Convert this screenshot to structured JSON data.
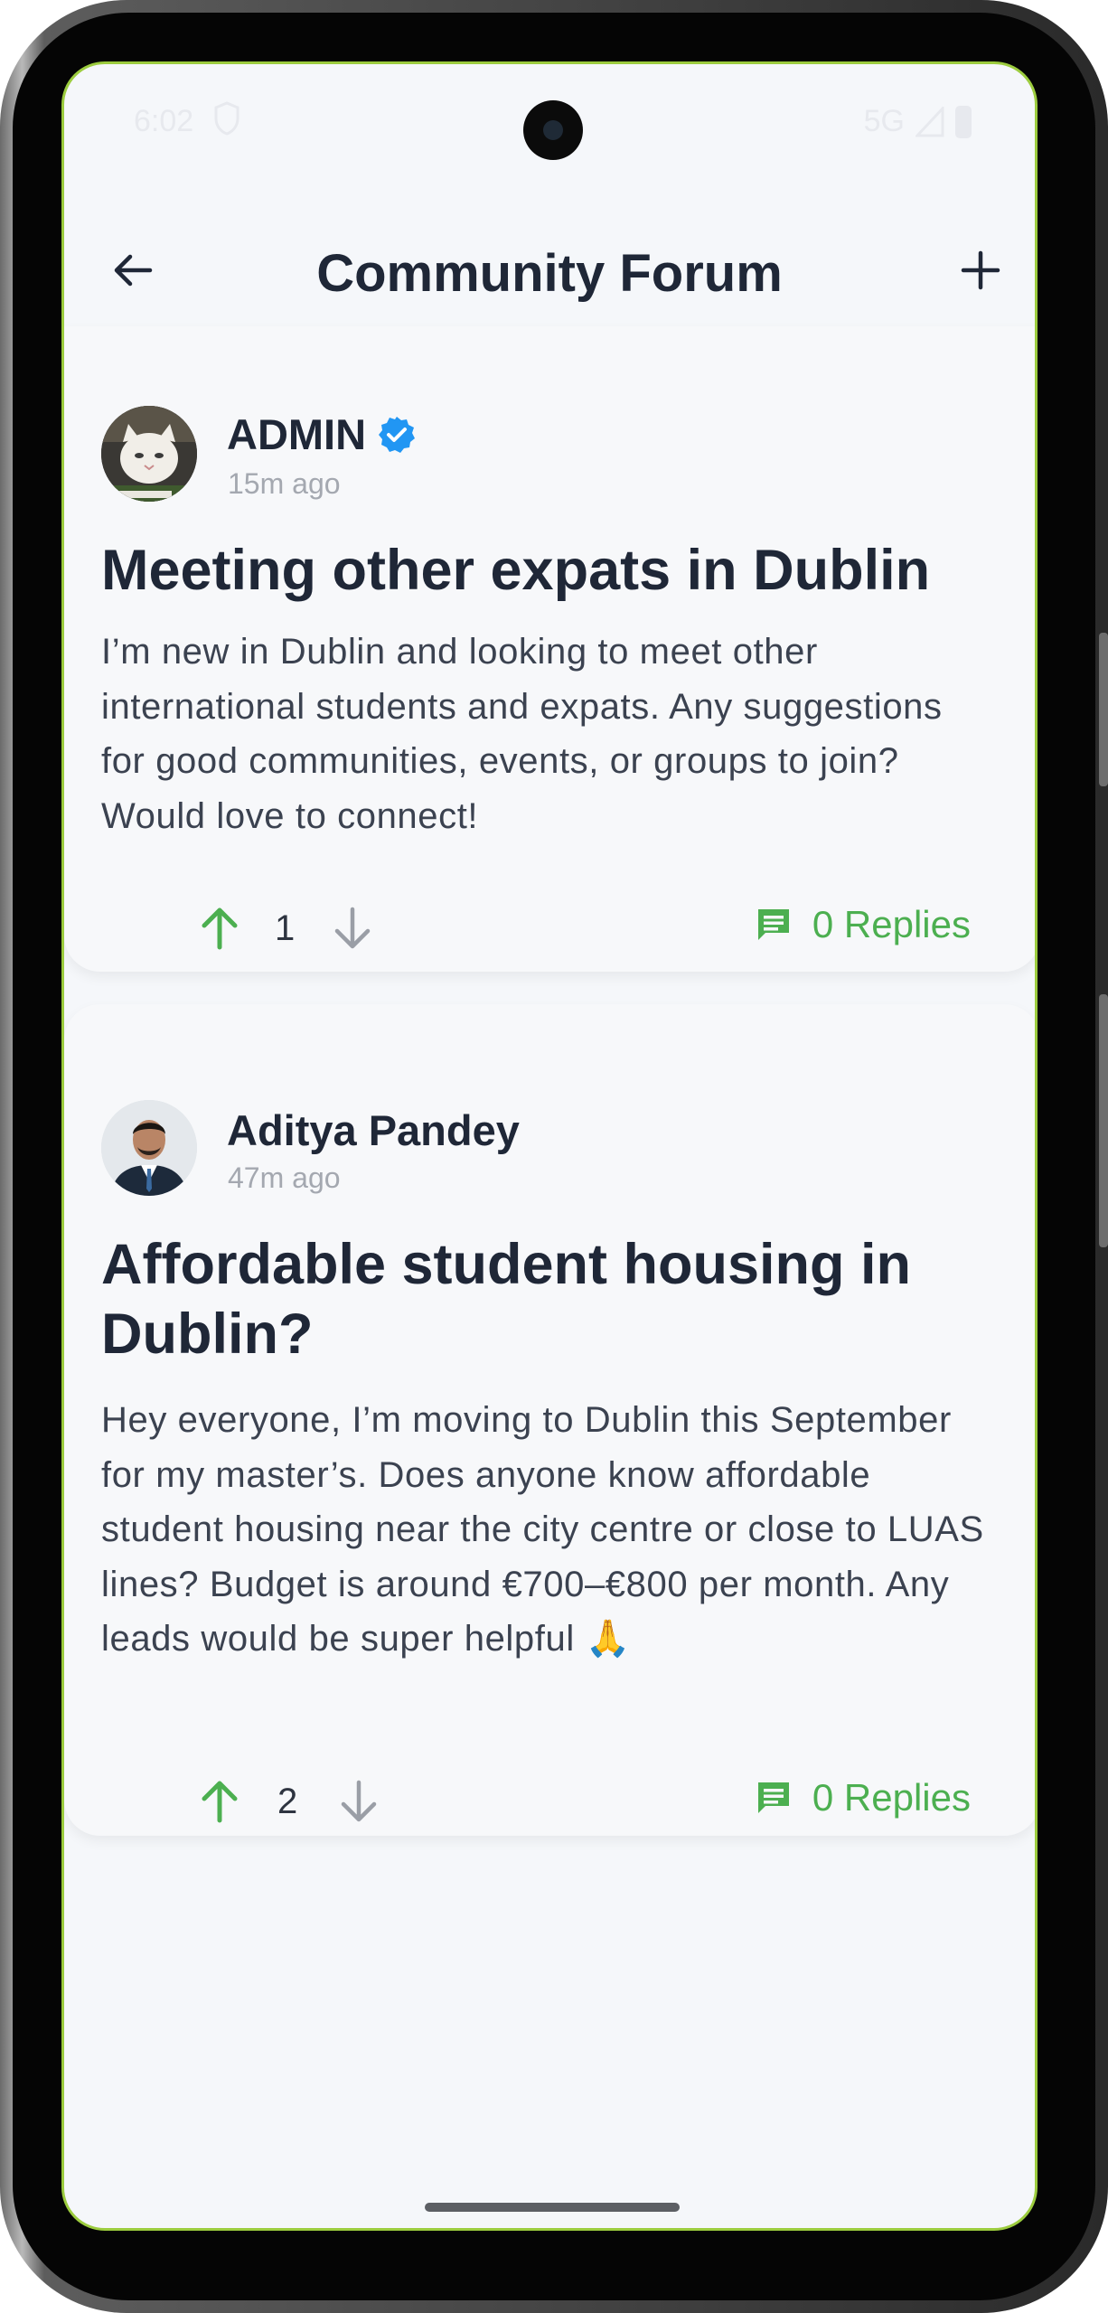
{
  "status_bar": {
    "time": "6:02",
    "network": "5G",
    "icons": [
      "shield-icon",
      "signal-icon",
      "battery-icon"
    ]
  },
  "header": {
    "title": "Community Forum",
    "back_icon": "arrow-left-icon",
    "add_icon": "plus-icon"
  },
  "posts": [
    {
      "author": "ADMIN",
      "verified": true,
      "time": "15m ago",
      "title": "Meeting other expats in Dublin",
      "body": "I’m new in Dublin and looking to meet other international students and expats. Any suggestions for good communities, events, or groups to join? Would love to connect!",
      "votes": "1",
      "replies_label": "0 Replies",
      "avatar": "cat-avatar"
    },
    {
      "author": "Aditya Pandey",
      "verified": false,
      "time": "47m ago",
      "title": "Affordable student housing in Dublin?",
      "body": "Hey everyone, I’m moving to Dublin this September for my master’s. Does anyone know affordable student housing near the city centre or close to LUAS lines? Budget is around €700–€800 per month. Any leads would be super helpful 🙏",
      "votes": "2",
      "replies_label": "0 Replies",
      "avatar": "person-avatar"
    }
  ],
  "colors": {
    "accent_green": "#4caf50",
    "verified_blue": "#2196f3",
    "title_dark": "#1f2737",
    "background": "#f5f7fa"
  }
}
